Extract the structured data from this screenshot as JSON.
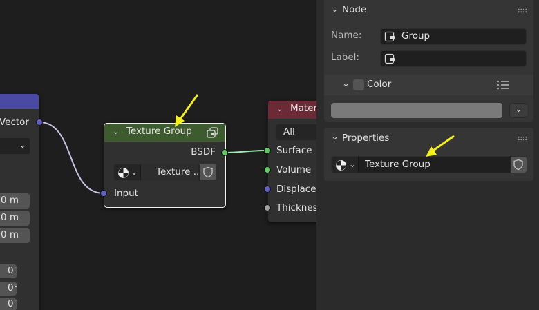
{
  "node_editor": {
    "left_node": {
      "socket_label": "Vector",
      "values": [
        "0 m",
        "0 m",
        "0 m"
      ],
      "angles": [
        "0°",
        "0°",
        "0°"
      ],
      "header_color": "#4a4aa5"
    },
    "group_node": {
      "title": "Texture Group",
      "output_label": "BSDF",
      "datablock_label": "Texture ...",
      "input_label": "Input",
      "header_color": "#3e5a2f"
    },
    "material_output": {
      "title": "Materi",
      "target_value": "All",
      "inputs": [
        "Surface",
        "Volume",
        "Displacem",
        "Thicknes"
      ],
      "header_color": "#6b2a35"
    },
    "socket_colors": {
      "shader": "#63c763",
      "vector": "#6363c7",
      "float": "#a1a1a1"
    }
  },
  "panel": {
    "node_section": {
      "title": "Node",
      "name_label": "Name:",
      "name_value": "Group",
      "label_label": "Label:",
      "label_value": "",
      "color_label": "Color"
    },
    "properties_section": {
      "title": "Properties",
      "datablock_value": "Texture Group"
    }
  },
  "annotation_color": "#f5f01a"
}
